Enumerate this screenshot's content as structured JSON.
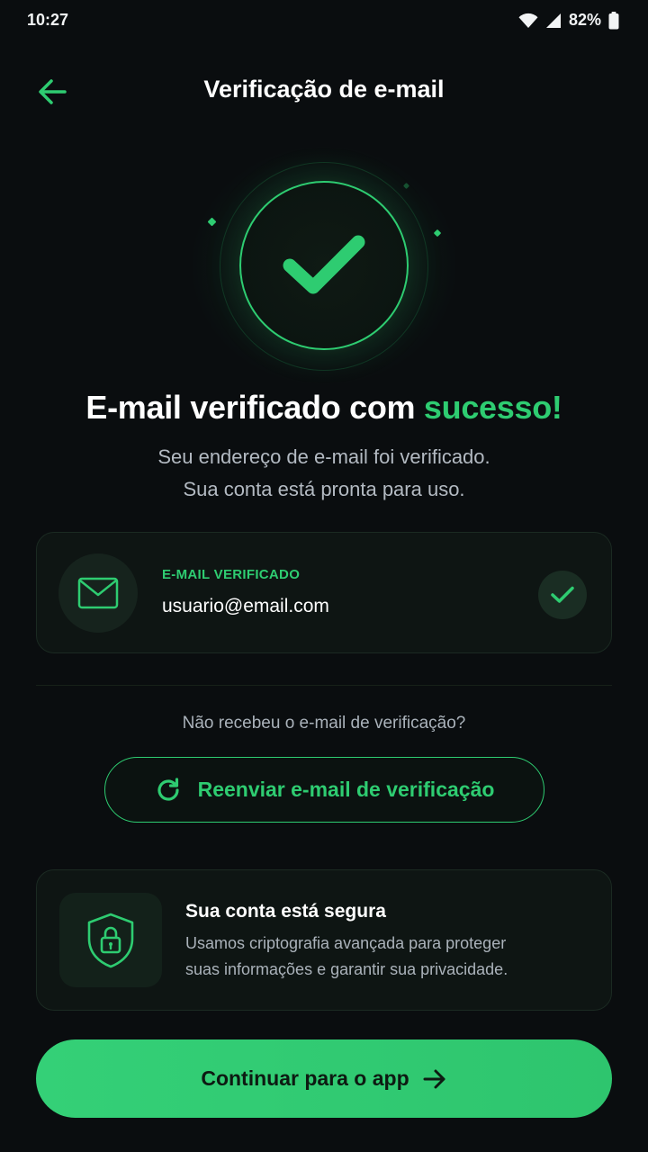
{
  "status_bar": {
    "time": "10:27",
    "battery": "82%"
  },
  "header": {
    "title": "Verificação de e-mail"
  },
  "hero": {
    "headline_prefix": "E-mail verificado com ",
    "headline_accent": "sucesso!",
    "subtext_line1": "Seu endereço de e-mail foi verificado.",
    "subtext_line2": "Sua conta está pronta para uso."
  },
  "email_card": {
    "label": "E-MAIL VERIFICADO",
    "email": "usuario@email.com"
  },
  "resend": {
    "question": "Não recebeu o e-mail de verificação?",
    "button_label": "Reenviar e-mail de verificação"
  },
  "security": {
    "title": "Sua conta está segura",
    "desc_line1": "Usamos criptografia avançada para proteger",
    "desc_line2": "suas informações e garantir sua privacidade."
  },
  "cta": {
    "label": "Continuar para o app"
  },
  "colors": {
    "background": "#0a0d0f",
    "accent": "#2ecc71",
    "text_primary": "#ffffff",
    "text_secondary": "#b3bac2"
  },
  "icons": {
    "back": "arrow-left-icon",
    "hero": "checkmark-icon",
    "mail": "envelope-icon",
    "verified": "check-icon",
    "resend": "refresh-icon",
    "security": "shield-lock-icon",
    "cta": "arrow-right-icon"
  }
}
